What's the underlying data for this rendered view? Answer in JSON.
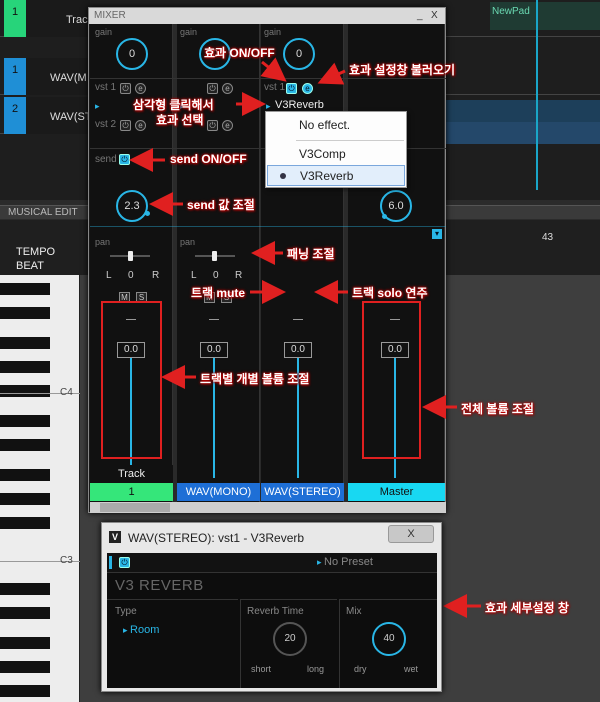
{
  "background": {
    "tracks": [
      {
        "number": "1",
        "name": "Trac",
        "color": "#27d47a"
      },
      {
        "number": "1",
        "name": "WAV(M",
        "color": "#1f8fd6"
      },
      {
        "number": "2",
        "name": "WAV(ST",
        "color": "#1f8fd6"
      }
    ],
    "newpad_label": "NewPad",
    "musical_edit_label": "MUSICAL EDIT",
    "tempo_label": "TEMPO",
    "beat_label": "BEAT",
    "ruler_number": "43",
    "key_labels": [
      "C4",
      "C3"
    ]
  },
  "mixer": {
    "title": "MIXER",
    "minimize": "_",
    "close": "X",
    "labels": {
      "gain": "gain",
      "send": "send",
      "pan": "pan",
      "vst1": "vst 1",
      "vst2": "vst 2"
    },
    "strips": [
      {
        "name_top": "Track",
        "name": "1",
        "gain": "0",
        "send": "2.3",
        "pan_l": "L",
        "pan_value": "0",
        "pan_r": "R",
        "volume": "0.0",
        "color": "#35e67a"
      },
      {
        "name": "WAV(MONO)",
        "gain": "0",
        "pan_l": "L",
        "pan_value": "0",
        "pan_r": "R",
        "volume": "0.0",
        "color": "#1e6fd6"
      },
      {
        "name": "WAV(STEREO)",
        "gain": "0",
        "volume": "0.0",
        "fx_name": "V3Reverb",
        "color": "#1e6fd6"
      },
      {
        "name": "Master",
        "send": "6.0",
        "volume": "0.0",
        "color": "#18d8f2"
      }
    ],
    "mute_label": "M",
    "solo_label": "S"
  },
  "dropdown": {
    "items": [
      "No effect.",
      "V3Comp",
      "V3Reverb"
    ],
    "selected_index": 2
  },
  "annotations": {
    "fx_onoff": "효과 ON/OFF",
    "fx_settings": "효과 설정창 불러오기",
    "triangle_select_1": "삼각형 클릭해서",
    "triangle_select_2": "효과 선택",
    "send_onoff": "send ON/OFF",
    "send_value": "send 값 조절",
    "panning": "패닝 조절",
    "track_mute": "트랙 mute",
    "track_solo": "트랙 solo 연주",
    "track_volume": "트랙별 개별 볼륨 조절",
    "master_volume": "전체 볼륨 조절",
    "fx_detail": "효과 세부설정 창"
  },
  "reverb": {
    "title": "WAV(STEREO): vst1 - V3Reverb",
    "vicon": "V",
    "close_label": "X",
    "preset": "No Preset",
    "name": "V3 REVERB",
    "type_label": "Type",
    "type_value": "Room",
    "reverb_time_label": "Reverb Time",
    "reverb_time_value": "20",
    "reverb_time_min": "short",
    "reverb_time_max": "long",
    "mix_label": "Mix",
    "mix_value": "40",
    "mix_min": "dry",
    "mix_max": "wet"
  },
  "colors": {
    "accent": "#29b6e6",
    "annotation_red": "#e02020"
  }
}
